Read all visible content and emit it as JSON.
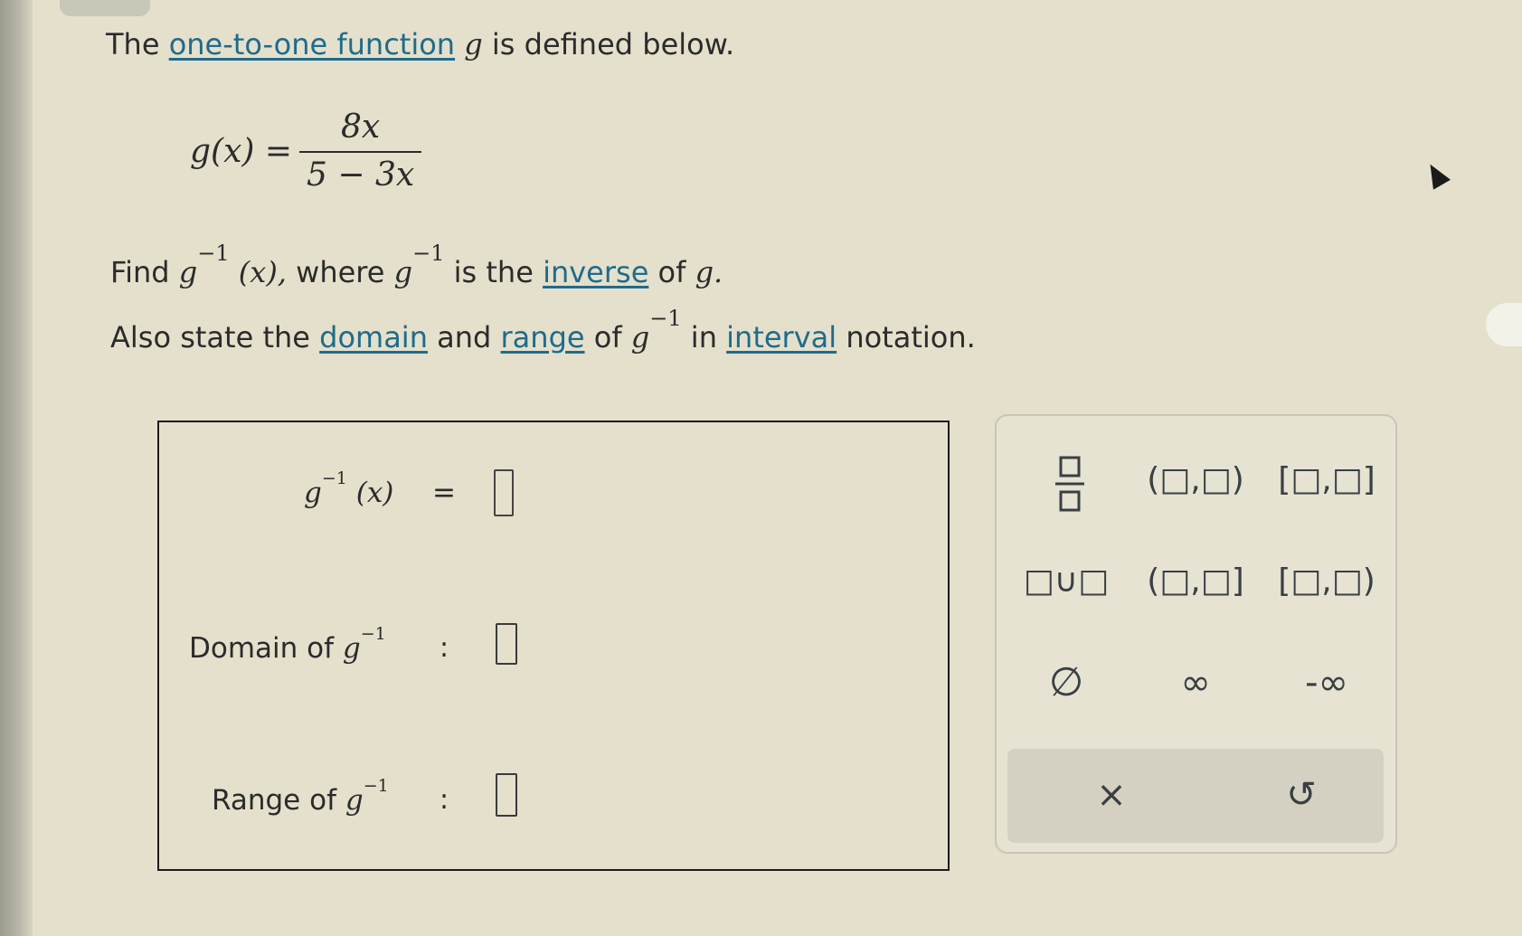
{
  "problem": {
    "line1_pre": "The",
    "line1_link": "one-to-one function",
    "line1_var": "g",
    "line1_post": "is defined below.",
    "formula_lhs": "g(x) =",
    "formula_numerator": "8x",
    "formula_denominator": "5 − 3x",
    "find_pre": "Find",
    "g": "g",
    "inv_exp": "−1",
    "x_paren": "(x),",
    "find_where": "where",
    "find_is_the": "is the",
    "find_link": "inverse",
    "find_of": "of",
    "find_end": "g.",
    "also_pre": "Also state the",
    "also_link_domain": "domain",
    "also_and": "and",
    "also_link_range": "range",
    "also_of": "of",
    "also_in": "in",
    "also_link_interval": "interval",
    "also_post": "notation."
  },
  "answer": {
    "row1_g": "g",
    "row1_exp": "−1",
    "row1_x": "(x)",
    "row1_eq": "=",
    "domain_label": "Domain of",
    "range_label": "Range of",
    "g": "g",
    "exp": "−1",
    "colon": ":"
  },
  "keypad": {
    "keys": [
      "□/□",
      "(□,□)",
      "[□,□]",
      "□∪□",
      "(□,□]",
      "[□,□)",
      "∅",
      "∞",
      "-∞"
    ],
    "clear_label": "×",
    "undo_label": "↺"
  }
}
